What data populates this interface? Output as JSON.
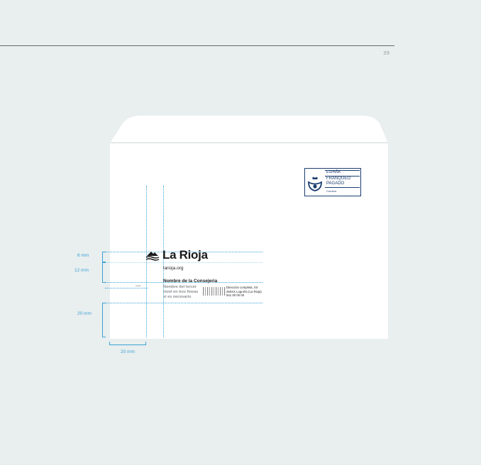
{
  "page": {
    "number": "39"
  },
  "stamp": {
    "country": "ESPAÑA",
    "line1": "FRANQUEO",
    "line2": "PAGADO",
    "brand": "Correos"
  },
  "letterhead": {
    "brand_name": "La Rioja",
    "website": "larioja.org",
    "department": "Nombre de la Consejería",
    "level_lines": [
      "Nombre del tercer",
      "nivel en tres líneas",
      "si es necesario"
    ],
    "address_lines": [
      "Dirección completa, XX",
      "260XX Logroño (La Rioja)",
      "941 00 00 00"
    ],
    "small_mark": "xxxxx"
  },
  "dimensions": {
    "top_margin": "6 mm",
    "logo_gap": "12 mm",
    "bottom_gap": "20 mm",
    "left_margin": "20 mm"
  },
  "colors": {
    "background": "#e9eeee",
    "guide": "#3aa3d8",
    "stamp": "#1b3d6e"
  }
}
